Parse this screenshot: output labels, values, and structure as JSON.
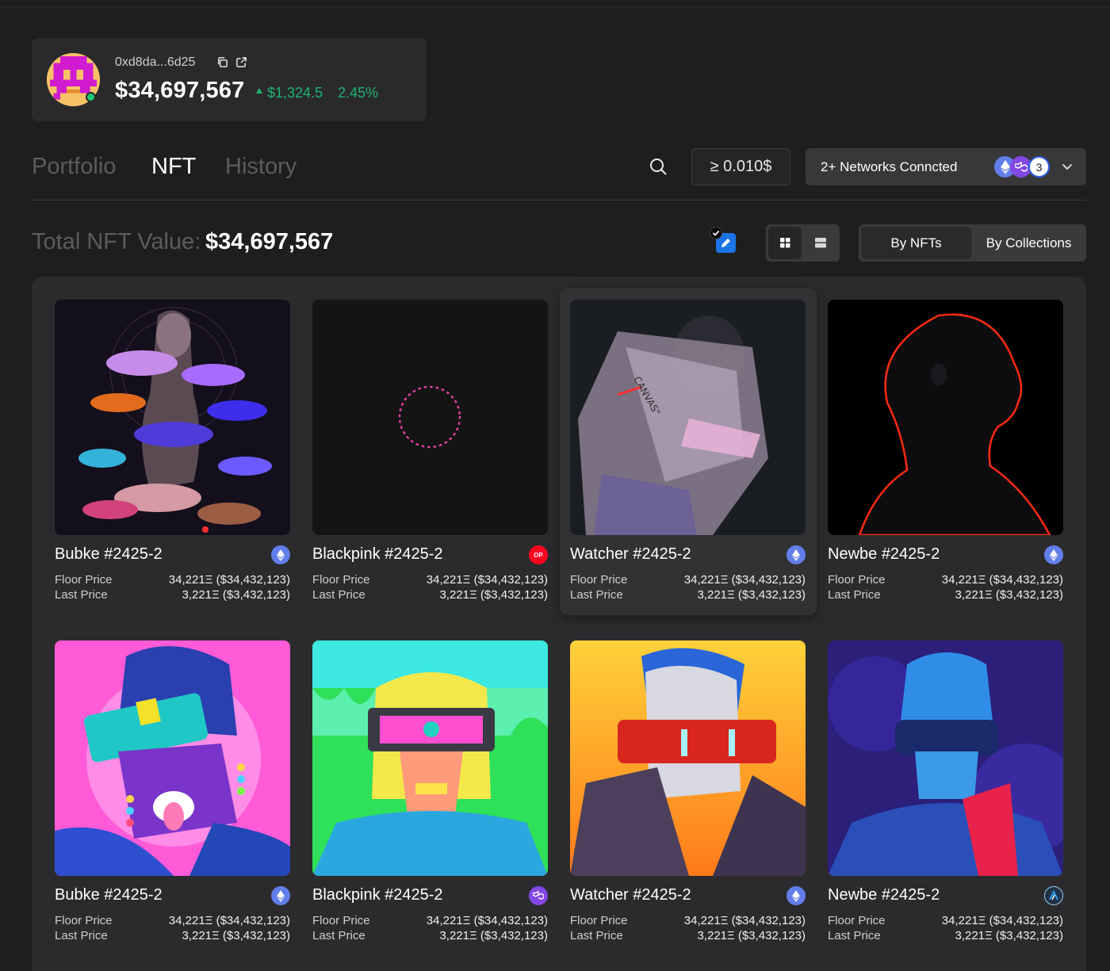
{
  "wallet": {
    "address": "0xd8da...6d25",
    "balance": "$34,697,567",
    "change_abs": "$1,324.5",
    "change_pct": "2.45%"
  },
  "tabs": [
    {
      "label": "Portfolio",
      "active": false
    },
    {
      "label": "NFT",
      "active": true
    },
    {
      "label": "History",
      "active": false
    }
  ],
  "filter": {
    "min_value": "≥  0.010$"
  },
  "networks": {
    "label": "2+ Networks Conncted",
    "count": "3"
  },
  "total": {
    "label": "Total NFT Value:",
    "value": "$34,697,567"
  },
  "view_mode": {
    "by_nfts": "By NFTs",
    "by_collections": "By Collections"
  },
  "labels": {
    "floor": "Floor Price",
    "last": "Last Price"
  },
  "nfts": [
    {
      "name": "Bubke #2425-2",
      "chain": "ethereum",
      "floor": "34,221Ξ ($34,432,123)",
      "last": "3,221Ξ ($3,432,123)"
    },
    {
      "name": "Blackpink #2425-2",
      "chain": "optimism",
      "floor": "34,221Ξ ($34,432,123)",
      "last": "3,221Ξ ($3,432,123)"
    },
    {
      "name": "Watcher #2425-2",
      "chain": "ethereum",
      "floor": "34,221Ξ ($34,432,123)",
      "last": "3,221Ξ ($3,432,123)"
    },
    {
      "name": "Newbe #2425-2",
      "chain": "ethereum",
      "floor": "34,221Ξ ($34,432,123)",
      "last": "3,221Ξ ($3,432,123)"
    },
    {
      "name": "Bubke #2425-2",
      "chain": "ethereum",
      "floor": "34,221Ξ ($34,432,123)",
      "last": "3,221Ξ ($3,432,123)"
    },
    {
      "name": "Blackpink #2425-2",
      "chain": "polygon",
      "floor": "34,221Ξ ($34,432,123)",
      "last": "3,221Ξ ($3,432,123)"
    },
    {
      "name": "Watcher #2425-2",
      "chain": "ethereum",
      "floor": "34,221Ξ ($34,432,123)",
      "last": "3,221Ξ ($3,432,123)"
    },
    {
      "name": "Newbe #2425-2",
      "chain": "arbitrum",
      "floor": "34,221Ξ ($34,432,123)",
      "last": "3,221Ξ ($3,432,123)"
    }
  ],
  "colors": {
    "positive": "#1fb372",
    "ethereum": "#627eea",
    "optimism": "#ff0420",
    "polygon": "#8247e5",
    "arbitrum": "#213147"
  }
}
